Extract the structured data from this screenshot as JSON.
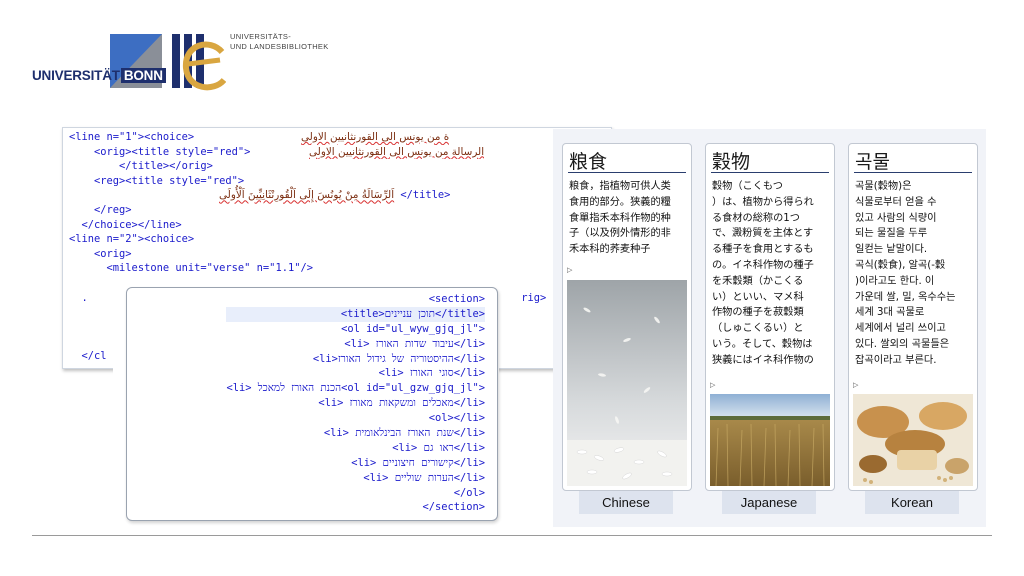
{
  "logo": {
    "university": "UNIVERSITÄT",
    "bonn": "BONN",
    "library_line1": "UNIVERSITÄTS-",
    "library_line2": "UND LANDESBIBLIOTHEK",
    "colors": {
      "navy": "#1e2f6d",
      "blue": "#3d6ec2",
      "gray": "#8a8f98",
      "gold": "#d9a640"
    }
  },
  "xml_panel": {
    "lines": [
      {
        "code": "<line n=\"1\"><choice>",
        "arabic": "ة من يونس الى القورنثانيين الاولى"
      },
      {
        "code": "    <orig><title style=\"red\">",
        "arabic": "الرسالة من يونس الى القورنثانيين الاولى"
      },
      {
        "code": "        </title></orig>",
        "arabic": ""
      },
      {
        "code": "    <reg><title style=\"red\">",
        "arabic": ""
      },
      {
        "code": "",
        "arabic": "اَلرِّسَالَةُ مِنْ يُونُسَ إِلَى اَلْقُورِنْثَانِيِّينَ اَلْأُولَى",
        "tail": "</title>"
      },
      {
        "code": "    </reg>",
        "arabic": ""
      },
      {
        "code": "  </choice></line>",
        "arabic": ""
      },
      {
        "code": "<line n=\"2\"><choice>",
        "arabic": ""
      },
      {
        "code": "    <orig>",
        "arabic": ""
      },
      {
        "code": "      <milestone unit=\"verse\" n=\"1.1\"/>",
        "arabic": ""
      },
      {
        "code": "",
        "arabic": ""
      },
      {
        "code": "  .",
        "arabic": "",
        "tail": "rig>"
      },
      {
        "code": "",
        "arabic": ""
      },
      {
        "code": "",
        "arabic": ""
      },
      {
        "code": "",
        "arabic": ""
      },
      {
        "code": "  </cl",
        "arabic": ""
      }
    ]
  },
  "hebrew_panel": {
    "lines": [
      {
        "text": "<section>"
      },
      {
        "text": "<title>תוכן עניינים</title>"
      },
      {
        "text": "<ol id=\"ul_wyw_gjq_jl\">"
      },
      {
        "text": "<li> עיבוד שדות האורז</li>"
      },
      {
        "text": "<li>ההיסטוריה של גידול האורז</li>"
      },
      {
        "text": "<li> סוגי האורז</li>"
      },
      {
        "text": "<li> הכנת האורז למאכל<ol id=\"ul_gzw_gjq_jl\">"
      },
      {
        "text": "<li> מאכלים ומשקאות מאורז</li>"
      },
      {
        "text": "<ol></li>"
      },
      {
        "text": "<li> שנת האורז הבינלאומית</li>"
      },
      {
        "text": "<li> ראו גם</li>"
      },
      {
        "text": "<li> קישורים חיצוניים</li>"
      },
      {
        "text": "<li> הערות שוליים</li>"
      },
      {
        "text": "</ol>"
      },
      {
        "text": "</section>"
      }
    ]
  },
  "comparison": {
    "cards": [
      {
        "title": "粮食",
        "lines": [
          "粮食，指植物可供人类",
          "食用的部分。狭義的糧",
          "食單指禾本科作物的种",
          "子（以及例外情形的非",
          "禾本科的荞麦种子"
        ],
        "caption": "Chinese",
        "photo": "rice-grains"
      },
      {
        "title": "穀物",
        "lines": [
          "穀物（こくもつ",
          "）は、植物から得られ",
          "る食材の総称の1つ",
          "で、澱粉質を主体とす",
          "る種子を食用とするも",
          "の。イネ科作物の種子",
          "を禾穀類（かこくる",
          "い）といい、マメ科",
          "作物の種子を菽穀類",
          "（しゅこくるい）と",
          "いう。そして、穀物は",
          "狭義にはイネ科作物の"
        ],
        "caption": "Japanese",
        "photo": "wheat-field"
      },
      {
        "title": "곡물",
        "lines": [
          "곡물(穀物)은",
          "식물로부터 얻을 수",
          "있고 사람의 식량이",
          "되는 물질을 두루",
          "일컫는 낱말이다.",
          "곡식(穀食), 알곡(-穀",
          ")이라고도 한다. 이",
          "가운데 쌀, 밀, 옥수수는",
          "세계 3대 곡물로",
          "세계에서 널리 쓰이고",
          "있다. 쌀외의 곡물들은",
          "잡곡이라고 부른다."
        ],
        "caption": "Korean",
        "photo": "bread-grains"
      }
    ]
  }
}
